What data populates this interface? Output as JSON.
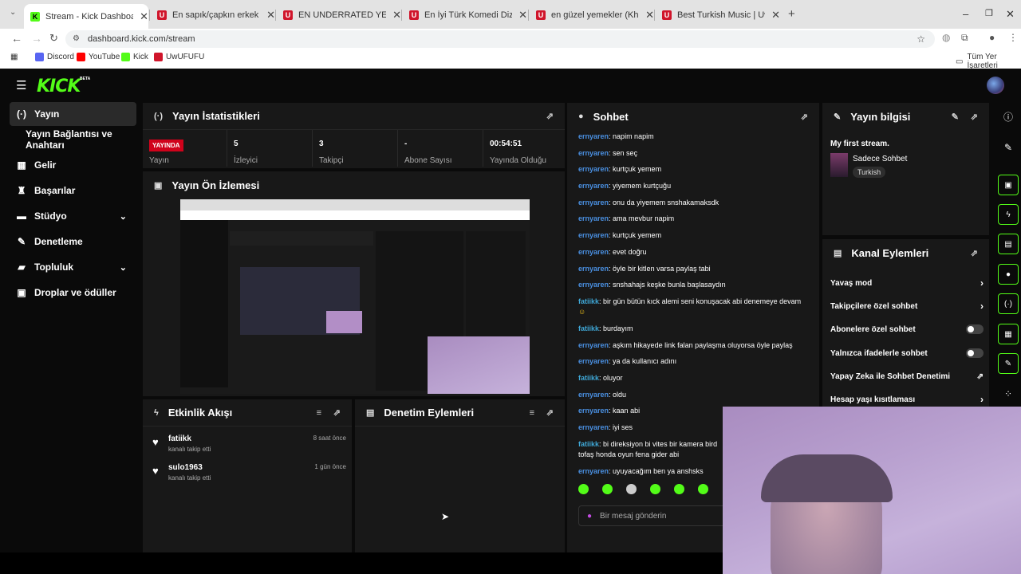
{
  "browser": {
    "tabs": [
      {
        "title": "Stream - Kick Dashboard",
        "fav": "K",
        "color": "#53fc18",
        "active": true
      },
      {
        "title": "En sapık/çapkın erkek ünlü | UwU",
        "fav": "U",
        "color": "#d0152b"
      },
      {
        "title": "EN UNDERRATED YEMEK | UwUFU",
        "fav": "U",
        "color": "#d0152b"
      },
      {
        "title": "En İyi Türk Komedi Dizisi | UwUF",
        "fav": "U",
        "color": "#d0152b"
      },
      {
        "title": "en güzel yemekler (Khione) | UwU",
        "fav": "U",
        "color": "#d0152b"
      },
      {
        "title": "Best Turkish Music | UwUFUFU",
        "fav": "U",
        "color": "#d0152b"
      }
    ],
    "url": "dashboard.kick.com/stream",
    "bookmarks": [
      {
        "label": "Discord",
        "color": "#5865f2"
      },
      {
        "label": "YouTube",
        "color": "#ff0000"
      },
      {
        "label": "Kick",
        "color": "#53fc18"
      },
      {
        "label": "UwUFUFU",
        "color": "#d0152b"
      }
    ],
    "all_bookmarks": "Tüm Yer İşaretleri"
  },
  "brand": {
    "logo": "KICK",
    "beta": "BETA",
    "accent": "#53fc18"
  },
  "sidebar": {
    "items": [
      {
        "label": "Yayın",
        "icon": "broadcast-icon",
        "glyph": "(·)",
        "active": true
      },
      {
        "label": "Yayın Bağlantısı ve Anahtarı",
        "icon": "",
        "glyph": ""
      },
      {
        "label": "Gelir",
        "icon": "revenue-icon",
        "glyph": "▦"
      },
      {
        "label": "Başarılar",
        "icon": "trophy-icon",
        "glyph": "♜"
      },
      {
        "label": "Stüdyo",
        "icon": "studio-icon",
        "glyph": "▬",
        "chevron": true
      },
      {
        "label": "Denetleme",
        "icon": "wrench-icon",
        "glyph": "✎"
      },
      {
        "label": "Topluluk",
        "icon": "community-icon",
        "glyph": "▰",
        "chevron": true
      },
      {
        "label": "Droplar ve ödüller",
        "icon": "drops-icon",
        "glyph": "▣"
      }
    ]
  },
  "stats": {
    "title": "Yayın İstatistikleri",
    "live_badge": "YAYINDA",
    "items": [
      {
        "value": "",
        "label": "Yayın"
      },
      {
        "value": "5",
        "label": "İzleyici"
      },
      {
        "value": "3",
        "label": "Takipçi"
      },
      {
        "value": "-",
        "label": "Abone Sayısı"
      },
      {
        "value": "00:54:51",
        "label": "Yayında Olduğu"
      }
    ]
  },
  "preview": {
    "title": "Yayın Ön İzlemesi"
  },
  "activity": {
    "title": "Etkinlik Akışı",
    "items": [
      {
        "name": "fatiikk",
        "desc": "kanalı takip etti",
        "time": "8 saat önce"
      },
      {
        "name": "sulo1963",
        "desc": "kanalı takip etti",
        "time": "1 gün önce"
      }
    ]
  },
  "moderation": {
    "title": "Denetim Eylemleri"
  },
  "chat": {
    "title": "Sohbet",
    "messages": [
      {
        "user": "ernyaren",
        "text": "napim napim",
        "color": "#4a90e2"
      },
      {
        "user": "ernyaren",
        "text": "sen seç",
        "color": "#4a90e2"
      },
      {
        "user": "ernyaren",
        "text": "kurtçuk yemem",
        "color": "#4a90e2"
      },
      {
        "user": "ernyaren",
        "text": "yiyemem kurtçuğu",
        "color": "#4a90e2"
      },
      {
        "user": "ernyaren",
        "text": "onu da yiyemem snshakamaksdk",
        "color": "#4a90e2"
      },
      {
        "user": "ernyaren",
        "text": "ama mevbur napim",
        "color": "#4a90e2"
      },
      {
        "user": "ernyaren",
        "text": "kurtçuk yemem",
        "color": "#4a90e2"
      },
      {
        "user": "ernyaren",
        "text": "evet doğru",
        "color": "#4a90e2"
      },
      {
        "user": "ernyaren",
        "text": "öyle bir kitlen varsa paylaş tabi",
        "color": "#4a90e2"
      },
      {
        "user": "ernyaren",
        "text": "snshahajs keşke bunla başlasaydın",
        "color": "#4a90e2"
      },
      {
        "user": "fatiikk",
        "text": "bir gün bütün kıck alemi seni konuşacak abi denemeye devam",
        "color": "#3fa7d6"
      },
      {
        "user": "fatiikk",
        "text": "burdayım",
        "color": "#3fa7d6"
      },
      {
        "user": "ernyaren",
        "text": "aşkım hikayede link falan paylaşma oluyorsa öyle paylaş",
        "color": "#4a90e2"
      },
      {
        "user": "ernyaren",
        "text": "ya da kullanıcı adını",
        "color": "#4a90e2"
      },
      {
        "user": "fatiikk",
        "text": "oluyor",
        "color": "#3fa7d6"
      },
      {
        "user": "ernyaren",
        "text": "oldu",
        "color": "#4a90e2"
      },
      {
        "user": "ernyaren",
        "text": "kaan abi",
        "color": "#4a90e2"
      },
      {
        "user": "ernyaren",
        "text": "iyi ses",
        "color": "#4a90e2"
      },
      {
        "user": "fatiikk",
        "text": "bi direksiyon bi vites bir kamera bird",
        "text2": "tofaş honda oyun fena gider abi",
        "color": "#3fa7d6"
      },
      {
        "user": "ernyaren",
        "text": "uyuyacağım ben ya anshsks",
        "color": "#4a90e2"
      }
    ],
    "input_placeholder": "Bir mesaj gönderin"
  },
  "stream_info": {
    "title": "Yayın bilgisi",
    "stream_title": "My first stream.",
    "category": "Sadece Sohbet",
    "tag": "Turkish"
  },
  "channel_actions": {
    "title": "Kanal Eylemleri",
    "items": [
      {
        "label": "Yavaş mod",
        "kind": "arrow"
      },
      {
        "label": "Takipçilere özel sohbet",
        "kind": "arrow"
      },
      {
        "label": "Abonelere özel sohbet",
        "kind": "toggle"
      },
      {
        "label": "Yalnızca ifadelerle sohbet",
        "kind": "toggle"
      },
      {
        "label": "Yapay Zeka ile Sohbet Denetimi",
        "kind": "external"
      },
      {
        "label": "Hesap yaşı kısıtlaması",
        "kind": "arrow"
      }
    ]
  }
}
